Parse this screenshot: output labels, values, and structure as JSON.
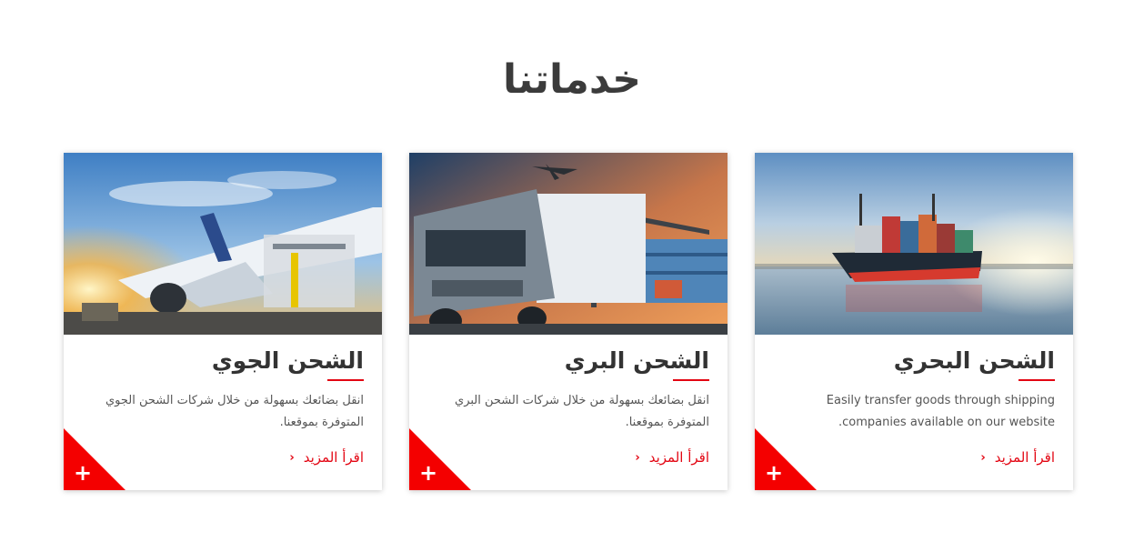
{
  "section": {
    "title": "خدماتنا"
  },
  "cards": [
    {
      "title": "الشحن البحري",
      "description": "Easily transfer goods through shipping companies available on our website.",
      "read_more": "اقرأ المزيد",
      "image": "cargo-ship-image"
    },
    {
      "title": "الشحن البري",
      "description": "انقل بضائعك بسهولة من خلال شركات الشحن البري المتوفرة بموقعنا.",
      "read_more": "اقرأ المزيد",
      "image": "truck-containers-image"
    },
    {
      "title": "الشحن الجوي",
      "description": "انقل بضائعك بسهولة من خلال شركات الشحن الجوي المتوفرة بموقعنا.",
      "read_more": "اقرأ المزيد",
      "image": "airplane-loading-image"
    }
  ],
  "colors": {
    "accent": "#e30613",
    "corner": "#f40000",
    "title": "#333333"
  },
  "icons": {
    "more": "chevron-left-icon",
    "expand": "plus-icon"
  }
}
